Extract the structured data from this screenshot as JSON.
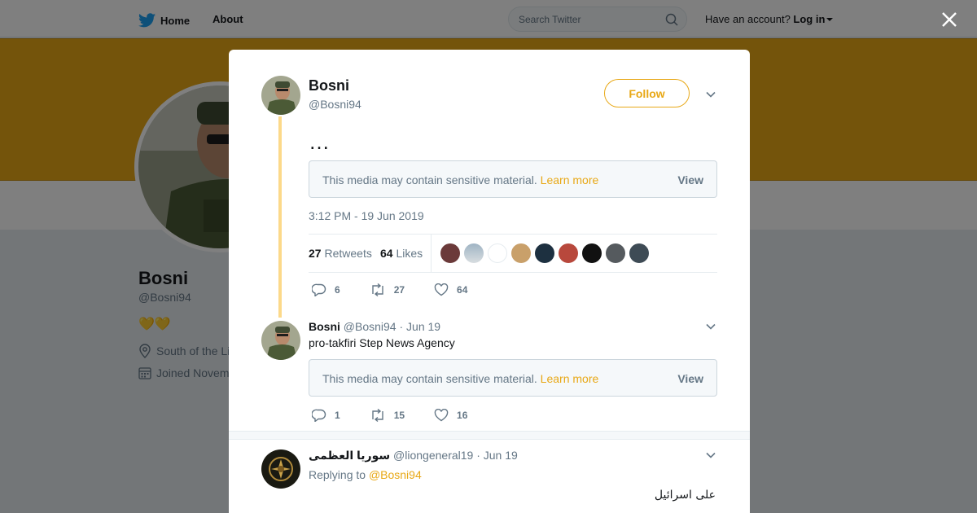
{
  "nav": {
    "home_label": "Home",
    "about_label": "About",
    "search_placeholder": "Search Twitter",
    "account_prompt": "Have an account?",
    "login_label": "Log in"
  },
  "profile": {
    "name": "Bosni",
    "handle": "@Bosni94",
    "bio_emoji": "💛💛",
    "location": "South of the Li",
    "joined": "Joined Novem"
  },
  "modal": {
    "tweet": {
      "author_name": "Bosni",
      "author_handle": "@Bosni94",
      "follow_label": "Follow",
      "text": "…",
      "sensitive_message": "This media may contain sensitive material.",
      "learn_more": "Learn more",
      "view_label": "View",
      "timestamp": "3:12 PM - 19 Jun 2019",
      "retweets_count": "27",
      "retweets_label": "Retweets",
      "likes_count": "64",
      "likes_label": "Likes",
      "reply_count": "6",
      "retweet_count": "27",
      "like_count": "64"
    },
    "reply1": {
      "author_name": "Bosni",
      "author_handle": "@Bosni94",
      "date": "· Jun 19",
      "text": "pro-takfiri Step News Agency",
      "sensitive_message": "This media may contain sensitive material.",
      "learn_more": "Learn more",
      "view_label": "View",
      "reply_count": "1",
      "retweet_count": "15",
      "like_count": "16"
    },
    "reply2": {
      "author_name": "سوريا العظمى",
      "author_handle": "@liongeneral19",
      "date": "· Jun 19",
      "replying_prefix": "Replying to",
      "replying_to": "@Bosni94",
      "text": "على اسرائيل"
    }
  },
  "colors": {
    "accent": "#e8a816",
    "thread_line": "#fcd98a",
    "muted_text": "#657786"
  }
}
